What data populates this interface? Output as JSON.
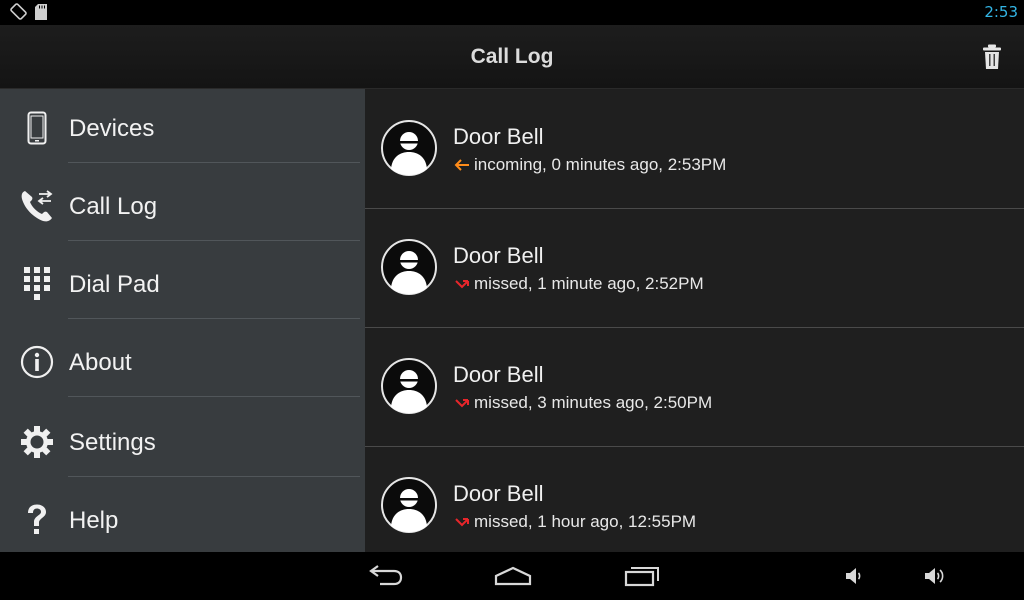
{
  "status_bar": {
    "time": "2:53",
    "icons": [
      "screen-rotation-icon",
      "sd-card-icon"
    ],
    "accent_color": "#33b5e5"
  },
  "action_bar": {
    "title": "Call Log",
    "action_icon": "trash-icon"
  },
  "drawer": {
    "items": [
      {
        "label": "Devices",
        "icon": "phone-device-icon"
      },
      {
        "label": "Call Log",
        "icon": "call-log-icon"
      },
      {
        "label": "Dial Pad",
        "icon": "dialpad-icon"
      },
      {
        "label": "About",
        "icon": "info-icon"
      },
      {
        "label": "Settings",
        "icon": "gear-icon"
      },
      {
        "label": "Help",
        "icon": "question-icon"
      }
    ]
  },
  "call_log": {
    "entries": [
      {
        "name": "Door Bell",
        "type": "incoming",
        "detail": "incoming, 0 minutes ago, 2:53PM",
        "arrow_color": "#ff8c1a"
      },
      {
        "name": "Door Bell",
        "type": "missed",
        "detail": "missed, 1 minute ago, 2:52PM",
        "arrow_color": "#e8262b"
      },
      {
        "name": "Door Bell",
        "type": "missed",
        "detail": "missed, 3 minutes ago, 2:50PM",
        "arrow_color": "#e8262b"
      },
      {
        "name": "Door Bell",
        "type": "missed",
        "detail": "missed, 1 hour ago, 12:55PM",
        "arrow_color": "#e8262b"
      }
    ]
  },
  "nav_bar": {
    "buttons": [
      "back-icon",
      "home-icon",
      "recent-apps-icon",
      "volume-down-icon",
      "volume-up-icon"
    ]
  }
}
